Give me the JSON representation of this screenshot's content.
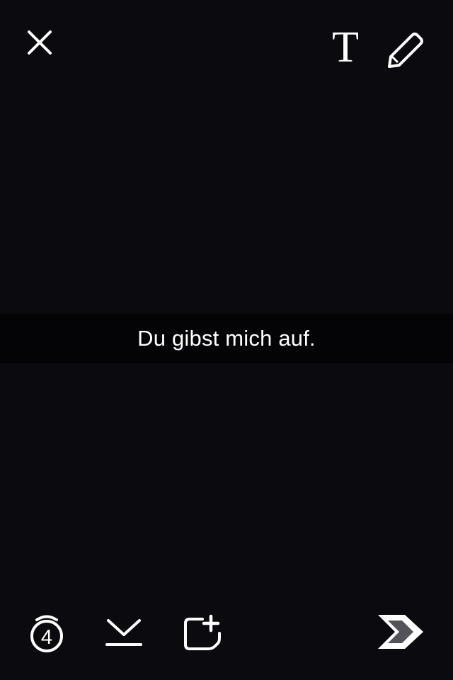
{
  "top_bar": {
    "close_icon": "close-icon",
    "text_tool_icon": "text-icon",
    "text_tool_glyph": "T",
    "draw_tool_icon": "pencil-icon"
  },
  "caption": {
    "text": "Du gibst mich auf."
  },
  "bottom_bar": {
    "timer_icon": "timer-icon",
    "timer_value": "4",
    "save_icon": "download-icon",
    "story_icon": "add-to-story-icon",
    "send_icon": "send-arrow-icon"
  },
  "colors": {
    "background": "#0b0a0f",
    "icon": "#ffffff",
    "send_accent": "#55535a"
  }
}
